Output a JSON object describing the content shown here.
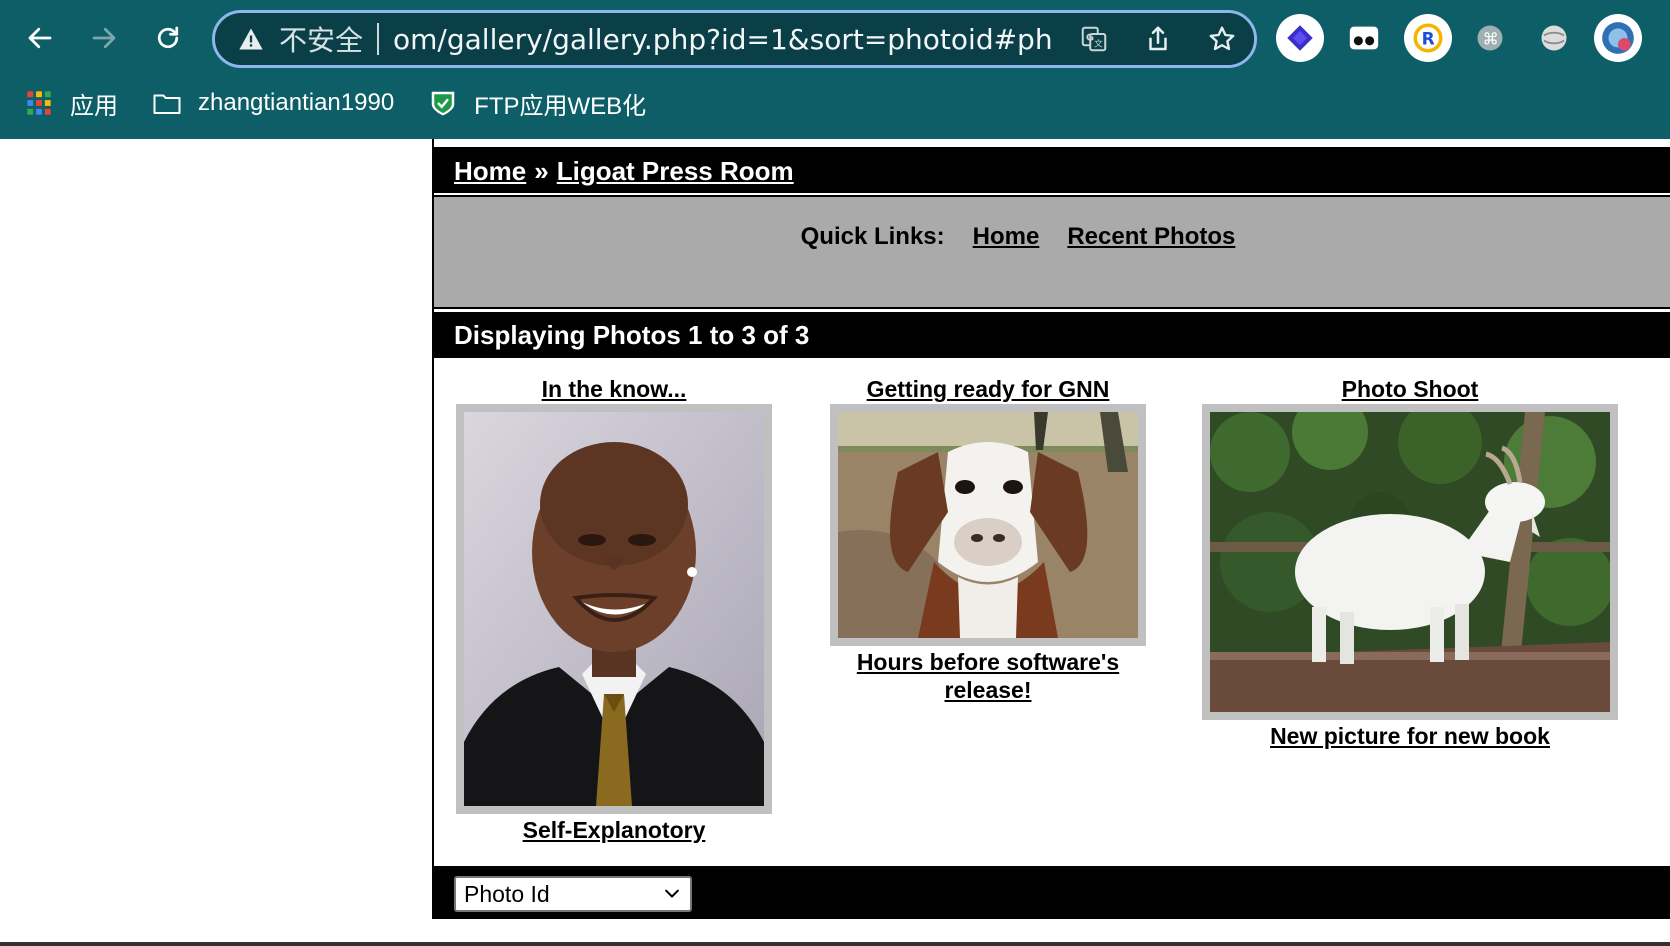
{
  "browser": {
    "insecure_label": "不安全",
    "url": "om/gallery/gallery.php?id=1&sort=photoid#photos",
    "bookmarks": [
      {
        "icon": "apps-grid-icon",
        "label": "应用"
      },
      {
        "icon": "folder-icon",
        "label": "zhangtiantian1990"
      },
      {
        "icon": "shield-check-icon",
        "label": "FTP应用WEB化"
      }
    ]
  },
  "breadcrumb": {
    "home": "Home",
    "separator": "»",
    "current": "Ligoat Press Room"
  },
  "quick_links": {
    "label": "Quick Links:",
    "home": "Home",
    "recent": "Recent Photos"
  },
  "gallery": {
    "displaying": "Displaying Photos 1 to 3 of 3",
    "photos": [
      {
        "title": "In the know...",
        "caption": "Self-Explanotory"
      },
      {
        "title": "Getting ready for GNN",
        "caption": "Hours before software's release!"
      },
      {
        "title": "Photo Shoot",
        "caption": "New picture for new book"
      }
    ]
  },
  "sort": {
    "selected": "Photo Id"
  },
  "colors": {
    "chrome": "#0e5e68",
    "omnibox": "#0a3f47",
    "quick_links_bg": "#aaaaaa",
    "frame": "#c0c0c0"
  }
}
